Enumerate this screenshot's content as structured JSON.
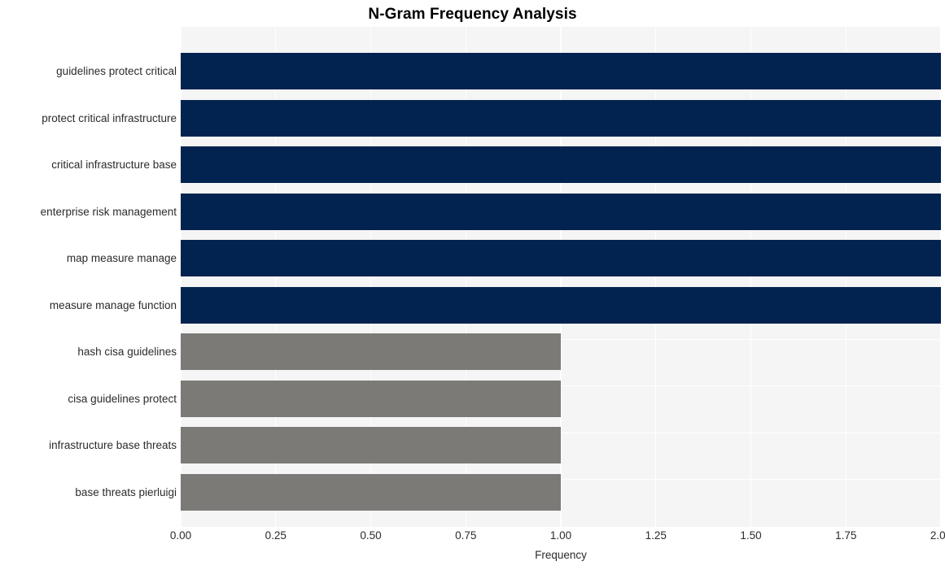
{
  "chart_data": {
    "type": "bar",
    "orientation": "horizontal",
    "title": "N-Gram Frequency Analysis",
    "xlabel": "Frequency",
    "ylabel": "",
    "xlim": [
      0,
      2
    ],
    "ylim": null,
    "grid": true,
    "legend": null,
    "categories": [
      "guidelines protect critical",
      "protect critical infrastructure",
      "critical infrastructure base",
      "enterprise risk management",
      "map measure manage",
      "measure manage function",
      "hash cisa guidelines",
      "cisa guidelines protect",
      "infrastructure base threats",
      "base threats pierluigi"
    ],
    "values": [
      2,
      2,
      2,
      2,
      2,
      2,
      1,
      1,
      1,
      1
    ],
    "bar_colors": [
      "#02234f",
      "#02234f",
      "#02234f",
      "#02234f",
      "#02234f",
      "#02234f",
      "#7b7a77",
      "#7b7a77",
      "#7b7a77",
      "#7b7a77"
    ],
    "xticks": [
      0,
      0.25,
      0.5,
      0.75,
      1,
      1.25,
      1.5,
      1.75,
      2
    ],
    "xtick_labels": [
      "0.00",
      "0.25",
      "0.50",
      "0.75",
      "1.00",
      "1.25",
      "1.50",
      "1.75",
      "2.00"
    ]
  },
  "style": {
    "plot_background": "#f5f5f5",
    "figure_background": "#ffffff",
    "grid_color": "#ffffff",
    "title_color": "#000000",
    "tick_color": "#2b2b2b",
    "color_high": "#02234f",
    "color_low": "#7b7a77"
  }
}
